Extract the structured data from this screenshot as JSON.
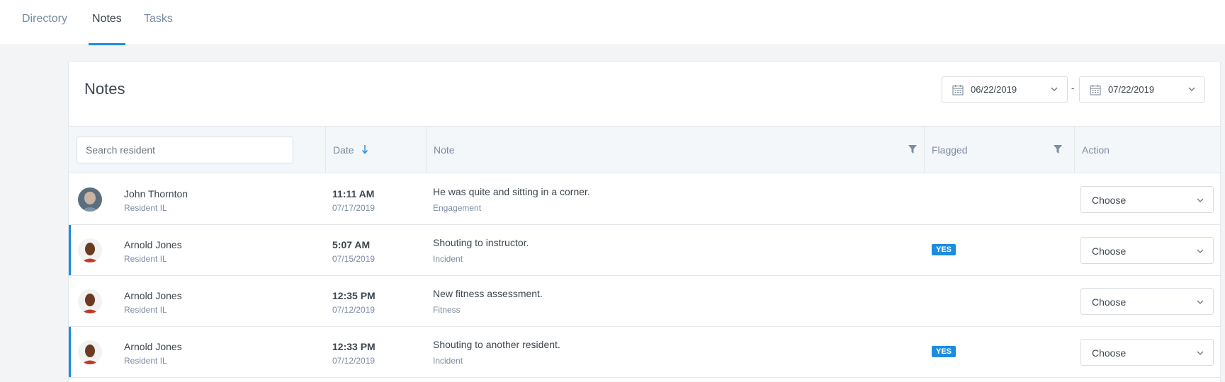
{
  "nav": {
    "tabs": [
      {
        "label": "Directory"
      },
      {
        "label": "Notes"
      },
      {
        "label": "Tasks"
      }
    ],
    "active": "Notes"
  },
  "card": {
    "title": "Notes"
  },
  "date_range": {
    "start": "06/22/2019",
    "separator": "-",
    "end": "07/22/2019"
  },
  "search": {
    "placeholder": "Search resident"
  },
  "columns": {
    "date": "Date",
    "note": "Note",
    "flagged": "Flagged",
    "action": "Action"
  },
  "colors": {
    "accent": "#1d8ce0"
  },
  "rows": [
    {
      "name": "John Thornton",
      "type": "Resident IL",
      "time": "11:11 AM",
      "date": "07/17/2019",
      "note": "He was quite and sitting in a corner.",
      "category": "Engagement",
      "flagged": "",
      "action": "Choose"
    },
    {
      "name": "Arnold Jones",
      "type": "Resident IL",
      "time": "5:07 AM",
      "date": "07/15/2019",
      "note": "Shouting to instructor.",
      "category": "Incident",
      "flagged": "YES",
      "action": "Choose"
    },
    {
      "name": "Arnold Jones",
      "type": "Resident IL",
      "time": "12:35 PM",
      "date": "07/12/2019",
      "note": "New fitness assessment.",
      "category": "Fitness",
      "flagged": "",
      "action": "Choose"
    },
    {
      "name": "Arnold Jones",
      "type": "Resident IL",
      "time": "12:33 PM",
      "date": "07/12/2019",
      "note": "Shouting to another resident.",
      "category": "Incident",
      "flagged": "YES",
      "action": "Choose"
    }
  ]
}
